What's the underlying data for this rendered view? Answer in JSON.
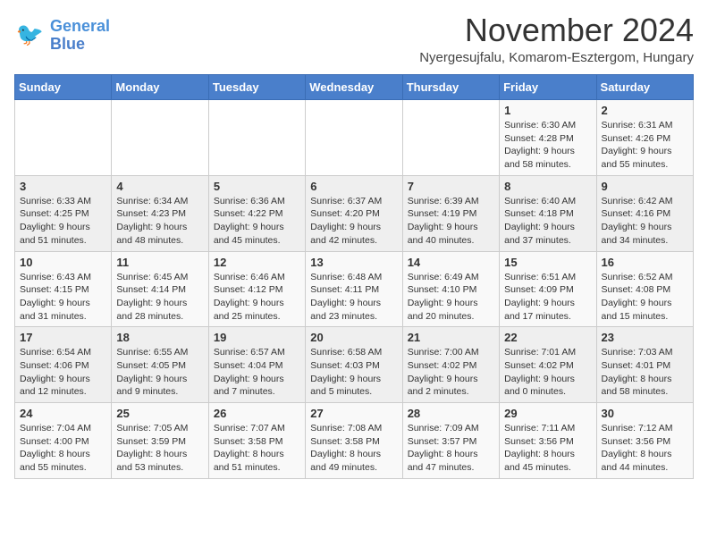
{
  "header": {
    "logo_line1": "General",
    "logo_line2": "Blue",
    "month_title": "November 2024",
    "location": "Nyergesujfalu, Komarom-Esztergom, Hungary"
  },
  "weekdays": [
    "Sunday",
    "Monday",
    "Tuesday",
    "Wednesday",
    "Thursday",
    "Friday",
    "Saturday"
  ],
  "weeks": [
    [
      {
        "day": "",
        "info": ""
      },
      {
        "day": "",
        "info": ""
      },
      {
        "day": "",
        "info": ""
      },
      {
        "day": "",
        "info": ""
      },
      {
        "day": "",
        "info": ""
      },
      {
        "day": "1",
        "info": "Sunrise: 6:30 AM\nSunset: 4:28 PM\nDaylight: 9 hours and 58 minutes."
      },
      {
        "day": "2",
        "info": "Sunrise: 6:31 AM\nSunset: 4:26 PM\nDaylight: 9 hours and 55 minutes."
      }
    ],
    [
      {
        "day": "3",
        "info": "Sunrise: 6:33 AM\nSunset: 4:25 PM\nDaylight: 9 hours and 51 minutes."
      },
      {
        "day": "4",
        "info": "Sunrise: 6:34 AM\nSunset: 4:23 PM\nDaylight: 9 hours and 48 minutes."
      },
      {
        "day": "5",
        "info": "Sunrise: 6:36 AM\nSunset: 4:22 PM\nDaylight: 9 hours and 45 minutes."
      },
      {
        "day": "6",
        "info": "Sunrise: 6:37 AM\nSunset: 4:20 PM\nDaylight: 9 hours and 42 minutes."
      },
      {
        "day": "7",
        "info": "Sunrise: 6:39 AM\nSunset: 4:19 PM\nDaylight: 9 hours and 40 minutes."
      },
      {
        "day": "8",
        "info": "Sunrise: 6:40 AM\nSunset: 4:18 PM\nDaylight: 9 hours and 37 minutes."
      },
      {
        "day": "9",
        "info": "Sunrise: 6:42 AM\nSunset: 4:16 PM\nDaylight: 9 hours and 34 minutes."
      }
    ],
    [
      {
        "day": "10",
        "info": "Sunrise: 6:43 AM\nSunset: 4:15 PM\nDaylight: 9 hours and 31 minutes."
      },
      {
        "day": "11",
        "info": "Sunrise: 6:45 AM\nSunset: 4:14 PM\nDaylight: 9 hours and 28 minutes."
      },
      {
        "day": "12",
        "info": "Sunrise: 6:46 AM\nSunset: 4:12 PM\nDaylight: 9 hours and 25 minutes."
      },
      {
        "day": "13",
        "info": "Sunrise: 6:48 AM\nSunset: 4:11 PM\nDaylight: 9 hours and 23 minutes."
      },
      {
        "day": "14",
        "info": "Sunrise: 6:49 AM\nSunset: 4:10 PM\nDaylight: 9 hours and 20 minutes."
      },
      {
        "day": "15",
        "info": "Sunrise: 6:51 AM\nSunset: 4:09 PM\nDaylight: 9 hours and 17 minutes."
      },
      {
        "day": "16",
        "info": "Sunrise: 6:52 AM\nSunset: 4:08 PM\nDaylight: 9 hours and 15 minutes."
      }
    ],
    [
      {
        "day": "17",
        "info": "Sunrise: 6:54 AM\nSunset: 4:06 PM\nDaylight: 9 hours and 12 minutes."
      },
      {
        "day": "18",
        "info": "Sunrise: 6:55 AM\nSunset: 4:05 PM\nDaylight: 9 hours and 9 minutes."
      },
      {
        "day": "19",
        "info": "Sunrise: 6:57 AM\nSunset: 4:04 PM\nDaylight: 9 hours and 7 minutes."
      },
      {
        "day": "20",
        "info": "Sunrise: 6:58 AM\nSunset: 4:03 PM\nDaylight: 9 hours and 5 minutes."
      },
      {
        "day": "21",
        "info": "Sunrise: 7:00 AM\nSunset: 4:02 PM\nDaylight: 9 hours and 2 minutes."
      },
      {
        "day": "22",
        "info": "Sunrise: 7:01 AM\nSunset: 4:02 PM\nDaylight: 9 hours and 0 minutes."
      },
      {
        "day": "23",
        "info": "Sunrise: 7:03 AM\nSunset: 4:01 PM\nDaylight: 8 hours and 58 minutes."
      }
    ],
    [
      {
        "day": "24",
        "info": "Sunrise: 7:04 AM\nSunset: 4:00 PM\nDaylight: 8 hours and 55 minutes."
      },
      {
        "day": "25",
        "info": "Sunrise: 7:05 AM\nSunset: 3:59 PM\nDaylight: 8 hours and 53 minutes."
      },
      {
        "day": "26",
        "info": "Sunrise: 7:07 AM\nSunset: 3:58 PM\nDaylight: 8 hours and 51 minutes."
      },
      {
        "day": "27",
        "info": "Sunrise: 7:08 AM\nSunset: 3:58 PM\nDaylight: 8 hours and 49 minutes."
      },
      {
        "day": "28",
        "info": "Sunrise: 7:09 AM\nSunset: 3:57 PM\nDaylight: 8 hours and 47 minutes."
      },
      {
        "day": "29",
        "info": "Sunrise: 7:11 AM\nSunset: 3:56 PM\nDaylight: 8 hours and 45 minutes."
      },
      {
        "day": "30",
        "info": "Sunrise: 7:12 AM\nSunset: 3:56 PM\nDaylight: 8 hours and 44 minutes."
      }
    ]
  ]
}
